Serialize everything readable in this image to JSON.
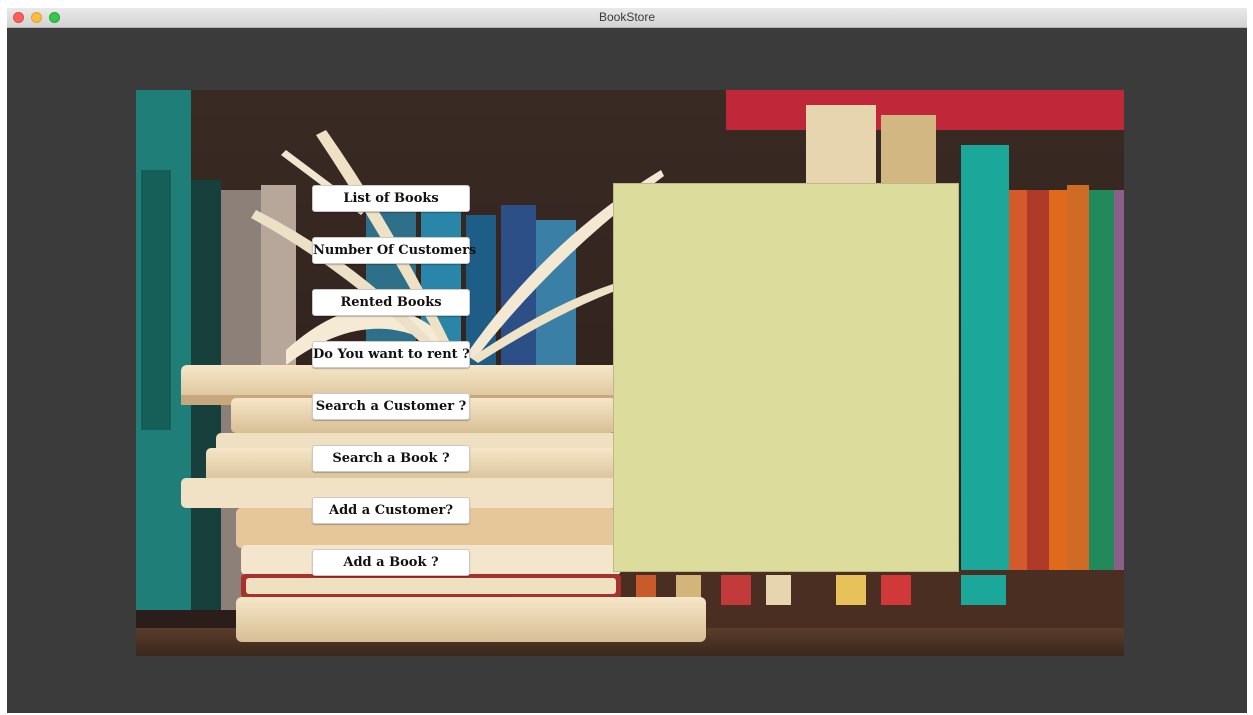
{
  "window": {
    "title": "BookStore"
  },
  "menu": {
    "items": [
      {
        "label": "List of Books"
      },
      {
        "label": "Number Of Customers"
      },
      {
        "label": "Rented Books"
      },
      {
        "label": "Do You want to rent ?"
      },
      {
        "label": "Search a Customer ?"
      },
      {
        "label": "Search a Book ?"
      },
      {
        "label": "Add a Customer?"
      },
      {
        "label": "Add a Book ?"
      }
    ]
  },
  "colors": {
    "window_bg": "#3b3b3b",
    "panel_bg": "#dcdc9c",
    "button_bg": "#ffffff"
  }
}
